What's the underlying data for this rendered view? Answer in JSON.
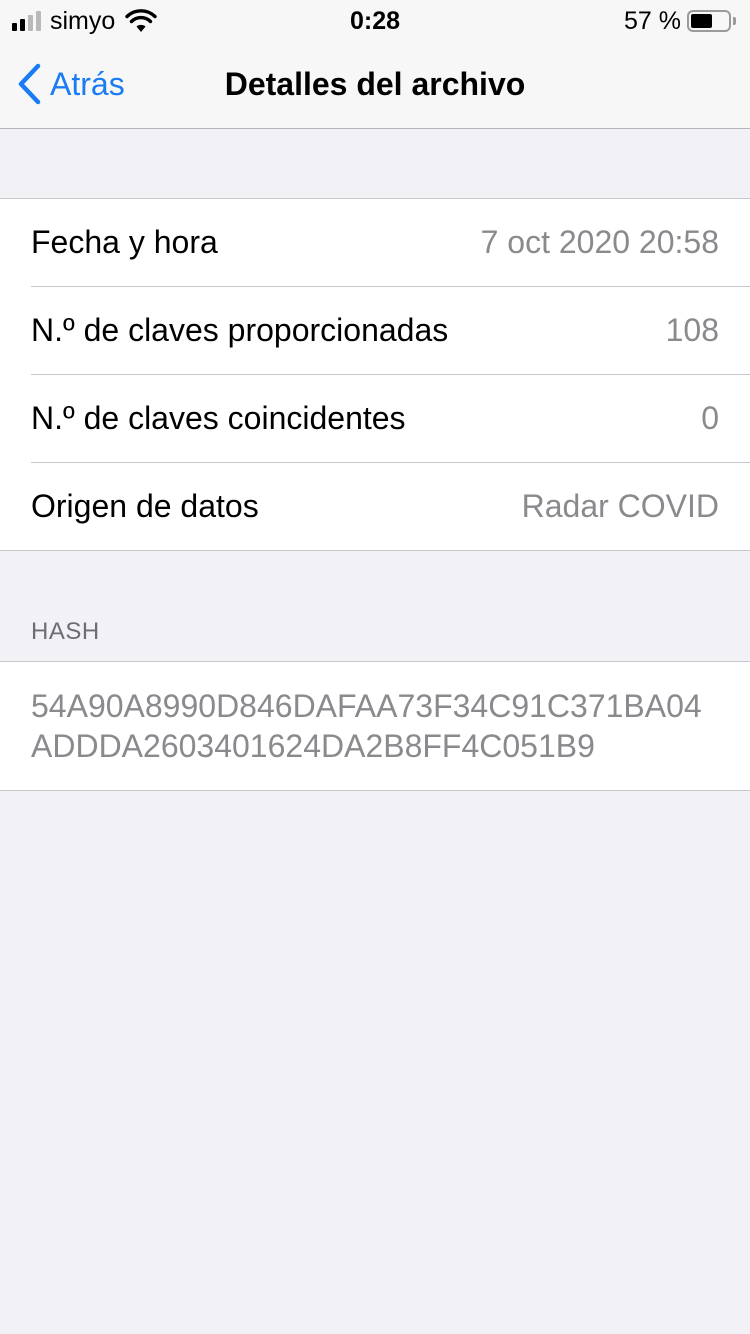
{
  "status_bar": {
    "carrier": "simyo",
    "time": "0:28",
    "battery_percent_label": "57 %",
    "battery_level": 0.57,
    "signal_bars_active": 2,
    "signal_bars_total": 4,
    "icons": [
      "signal-icon",
      "wifi-icon",
      "battery-icon"
    ]
  },
  "nav": {
    "back_label": "Atrás",
    "title": "Detalles del archivo",
    "accent_color": "#1a7cf4"
  },
  "details": {
    "rows": [
      {
        "label": "Fecha y hora",
        "value": "7 oct 2020 20:58"
      },
      {
        "label": "N.º de claves proporcionadas",
        "value": "108"
      },
      {
        "label": "N.º de claves coincidentes",
        "value": "0"
      },
      {
        "label": "Origen de datos",
        "value": "Radar COVID"
      }
    ]
  },
  "hash": {
    "header": "HASH",
    "value": "54A90A8990D846DAFAA73F34C91C371BA04ADDDA2603401624DA2B8FF4C051B9"
  }
}
